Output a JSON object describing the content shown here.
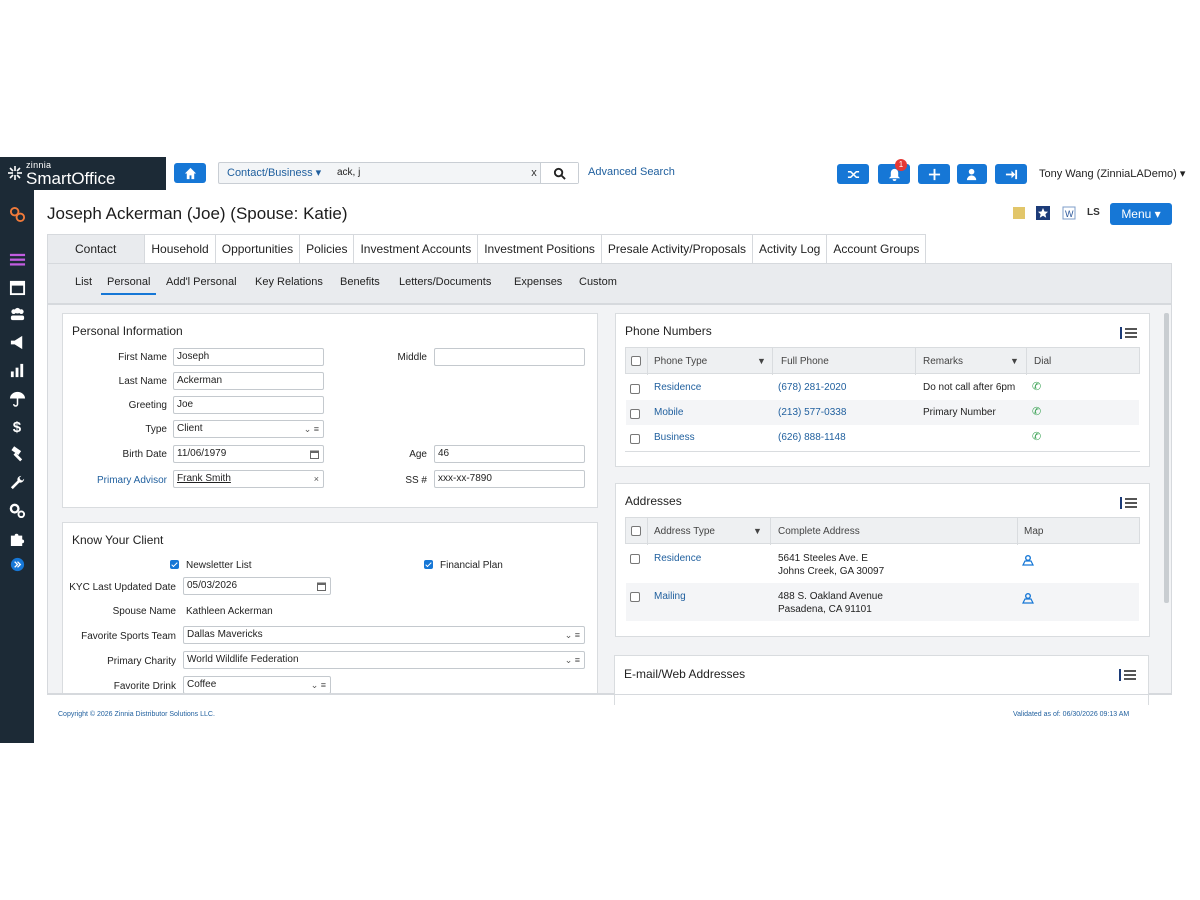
{
  "brand": {
    "small": "zinnia",
    "big": "SmartOffice"
  },
  "topbar": {
    "search_scope": "Contact/Business ▾",
    "search_value": "ack, j",
    "search_clear": "x",
    "advanced_search": "Advanced Search",
    "notification_count": "1",
    "user": "Tony Wang (ZinniaLADemo) ▾"
  },
  "header": {
    "title": "Joseph Ackerman (Joe) (Spouse: Katie)",
    "ls": "LS",
    "menu": "Menu ▾"
  },
  "tabs": [
    "Contact",
    "Household",
    "Opportunities",
    "Policies",
    "Investment Accounts",
    "Investment Positions",
    "Presale Activity/Proposals",
    "Activity Log",
    "Account Groups"
  ],
  "subnav": [
    "List",
    "Personal",
    "Add'l Personal",
    "Key Relations",
    "Benefits",
    "Letters/Documents",
    "Expenses",
    "Custom"
  ],
  "personal": {
    "title": "Personal Information",
    "first_name_label": "First Name",
    "first_name": "Joseph",
    "middle_label": "Middle",
    "middle": "",
    "last_name_label": "Last Name",
    "last_name": "Ackerman",
    "greeting_label": "Greeting",
    "greeting": "Joe",
    "type_label": "Type",
    "type": "Client",
    "birth_label": "Birth Date",
    "birth": "11/06/1979",
    "age_label": "Age",
    "age": "46",
    "advisor_label": "Primary Advisor",
    "advisor": "Frank Smith",
    "advisor_clear": "×",
    "ss_label": "SS #",
    "ss": "xxx-xx-7890"
  },
  "kyc": {
    "title": "Know Your Client",
    "newsletter": "Newsletter List",
    "financial_plan": "Financial Plan",
    "updated_label": "KYC Last Updated Date",
    "updated": "05/03/2026",
    "spouse_label": "Spouse Name",
    "spouse": "Kathleen Ackerman",
    "sports_label": "Favorite Sports Team",
    "sports": "Dallas Mavericks",
    "charity_label": "Primary Charity",
    "charity": "World Wildlife Federation",
    "drink_label": "Favorite Drink",
    "drink": "Coffee"
  },
  "phones": {
    "title": "Phone Numbers",
    "headers": [
      "Phone Type",
      "Full Phone",
      "Remarks",
      "Dial"
    ],
    "rows": [
      {
        "type": "Residence",
        "phone": "(678) 281-2020",
        "remarks": "Do not call after 6pm"
      },
      {
        "type": "Mobile",
        "phone": "(213) 577-0338",
        "remarks": "Primary Number"
      },
      {
        "type": "Business",
        "phone": "(626) 888-1148",
        "remarks": ""
      }
    ]
  },
  "addresses": {
    "title": "Addresses",
    "headers": [
      "Address Type",
      "Complete Address",
      "Map"
    ],
    "rows": [
      {
        "type": "Residence",
        "line1": "5641 Steeles Ave. E",
        "line2": "Johns Creek, GA 30097"
      },
      {
        "type": "Mailing",
        "line1": "488 S. Oakland Avenue",
        "line2": "Pasadena, CA 91101"
      }
    ]
  },
  "emails": {
    "title": "E-mail/Web Addresses"
  },
  "footer": {
    "copyright": "Copyright © 2026 Zinnia Distributor Solutions LLC.",
    "validated": "Validated as of: 06/30/2026 09:13 AM"
  },
  "colors": {
    "sidebar": "#1c2a36",
    "accent": "#1677d6",
    "link": "#1f5f9e"
  }
}
